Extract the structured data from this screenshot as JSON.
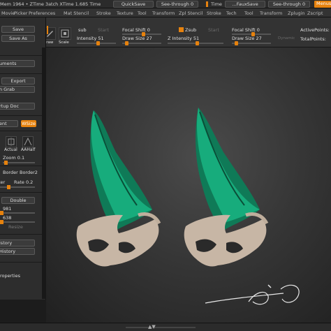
{
  "statusbar": {
    "mem_text": "Mem 1964 • ZTime 3atch XTime 1.685 Time",
    "quicksave": "QuickSave",
    "see_through_1": "See-through",
    "see_through_1_value": "0",
    "time_label": "Time",
    "fauxsave": "…FauxSave",
    "see_through_2": "See-through",
    "see_through_2_value": "0",
    "menus": "Menus"
  },
  "menubar": {
    "items": [
      "Movie",
      "Picker",
      "Preferences",
      "Mat Stencil",
      "Stroke",
      "Texture",
      "Tool",
      "Transform",
      "Zpl Stencil",
      "Stroke",
      "Tech",
      "Tool",
      "Transform",
      "Zplugin",
      "Zscript"
    ]
  },
  "shelf": {
    "tile_labels": [
      "Draw",
      "Scale"
    ],
    "sub_label": "sub",
    "start_label_1": "Start",
    "intensity_label": "Intensity 51",
    "focal_shift_1": "Focal Shift",
    "focal_shift_1_value": "0",
    "draw_size_1": "Draw Size 27",
    "zsub_label": "Zsub",
    "z_intensity": "Z Intensity 51",
    "start_label_2": "Start",
    "focal_shift_2": "Focal Shift",
    "focal_shift_2_value": "0",
    "draw_size_2": "Draw Size 27",
    "dynamic_label": "Dynamic",
    "active_points": "ActivePoints:",
    "total_points": "TotalPoints:"
  },
  "leftpanel": {
    "save": "Save",
    "save_as": "Save As",
    "documents": "uments",
    "export": "Export",
    "grab": "n Grab",
    "startup_doc": "rtup Doc",
    "ent": "ent",
    "wsize": "WSize",
    "actual": "Actual",
    "aahalf": "AAHalf",
    "zoom": "Zoom 0.1",
    "border": "Border",
    "border2": "Border2",
    "ter": "ter",
    "rate": "Rate 0.2",
    "double": "Double",
    "v981": "981",
    "v638": "638",
    "resize": "Resize",
    "history1": "istory",
    "history2": "History",
    "properties": "roperties"
  },
  "colors": {
    "accent": "#e6820e",
    "teal_model": "#15a87a",
    "bone_model": "#c8b8a8"
  },
  "icons": [
    "draw-icon",
    "scale-icon",
    "actual-icon",
    "aahalf-icon",
    "scroll-icon"
  ]
}
